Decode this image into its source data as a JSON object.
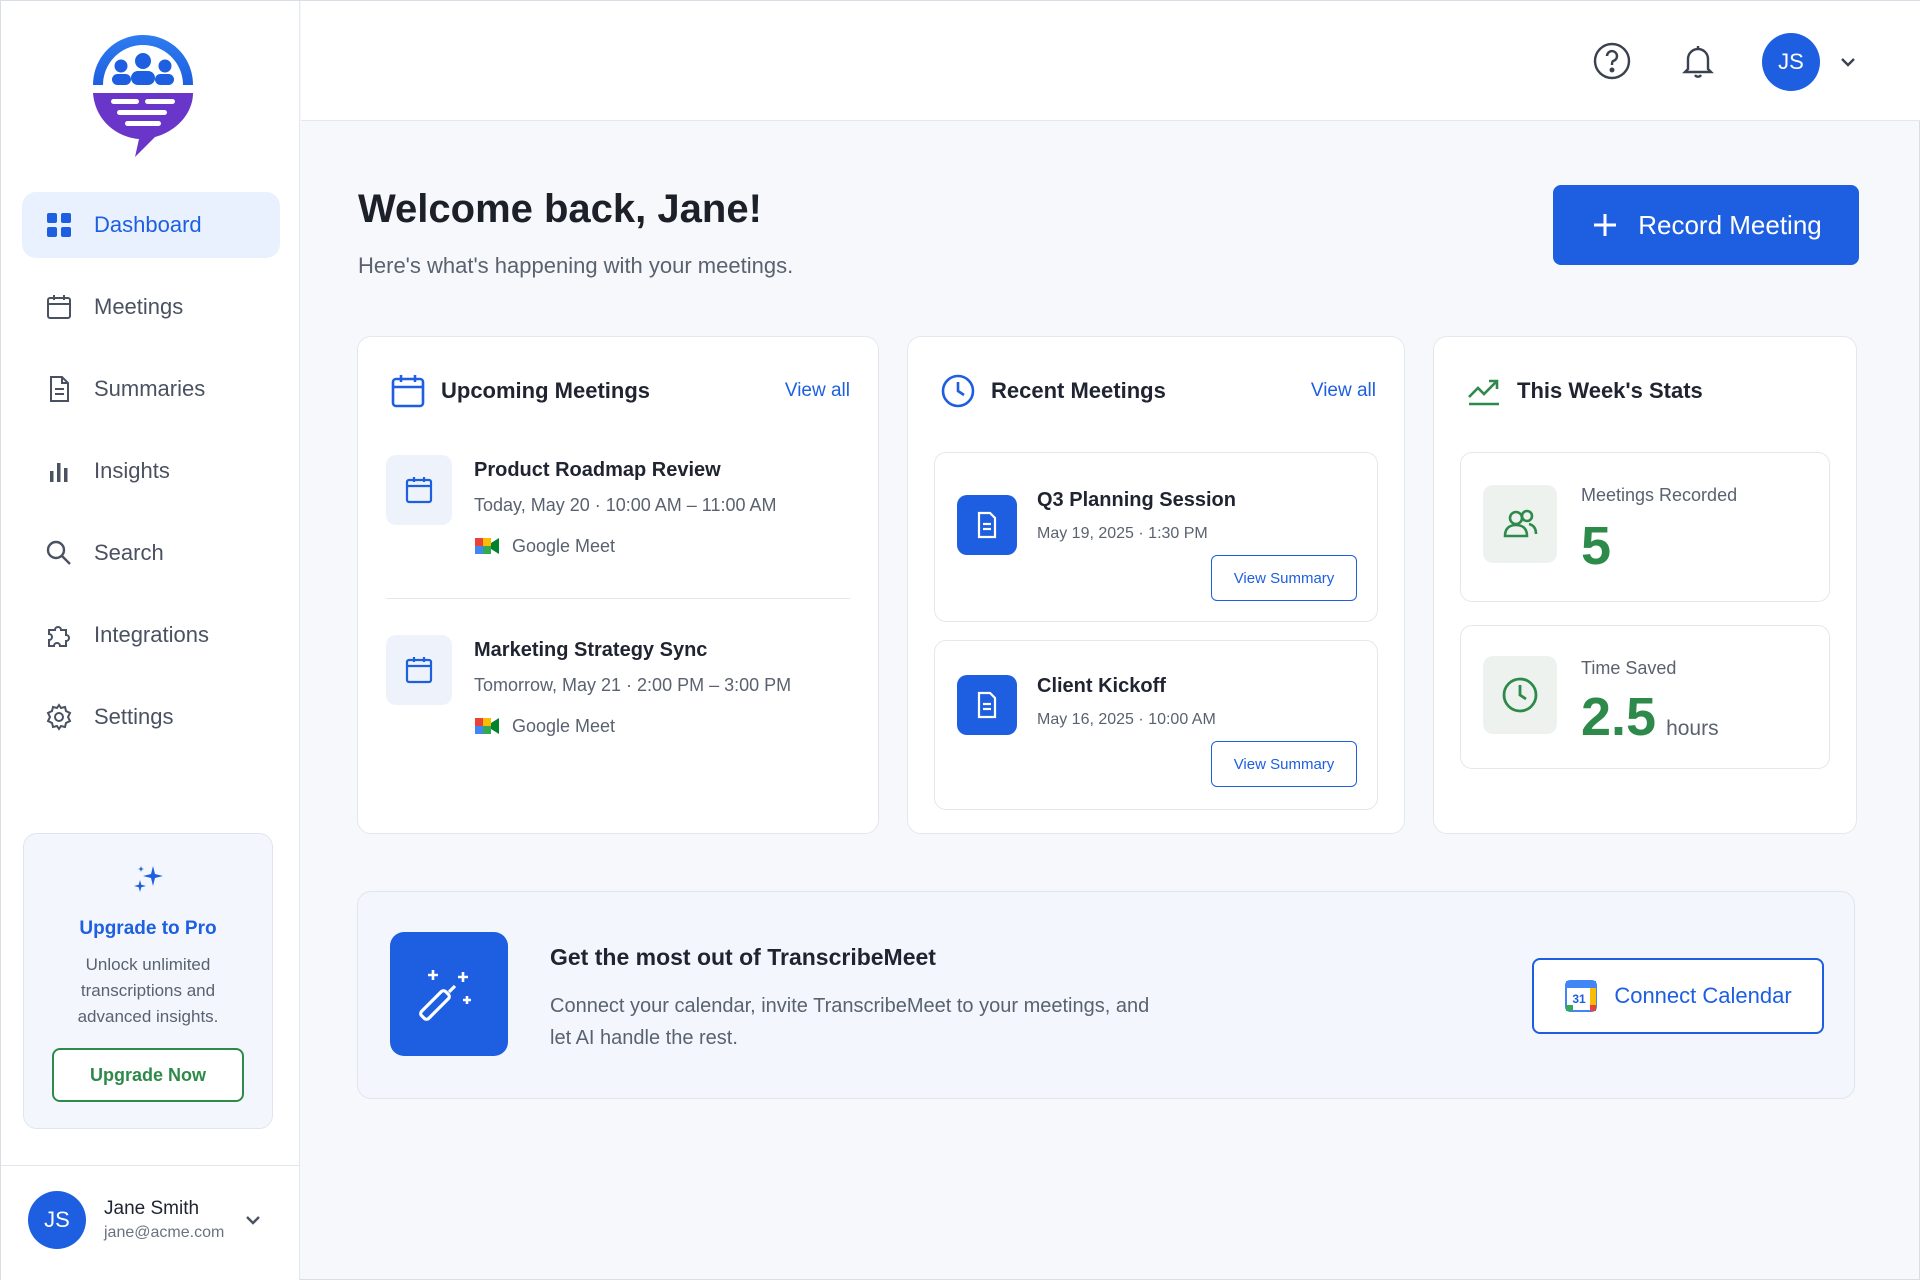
{
  "app": {
    "name": "TranscribeMeet"
  },
  "sidebar": {
    "items": [
      {
        "label": "Dashboard",
        "icon": "dashboard-icon",
        "active": true
      },
      {
        "label": "Meetings",
        "icon": "calendar-icon"
      },
      {
        "label": "Summaries",
        "icon": "document-icon"
      },
      {
        "label": "Insights",
        "icon": "bar-chart-icon"
      },
      {
        "label": "Search",
        "icon": "search-icon"
      },
      {
        "label": "Integrations",
        "icon": "puzzle-icon"
      },
      {
        "label": "Settings",
        "icon": "gear-icon"
      }
    ],
    "upgrade": {
      "title": "Upgrade to Pro",
      "text": "Unlock unlimited transcriptions and advanced insights.",
      "button": "Upgrade Now"
    },
    "user": {
      "initials": "JS",
      "name": "Jane Smith",
      "email": "jane@acme.com"
    }
  },
  "header": {
    "avatar_initials": "JS"
  },
  "main": {
    "welcome": "Welcome back, Jane!",
    "subtitle": "Here's what's happening with your meetings.",
    "record_button": "Record Meeting",
    "upcoming": {
      "title": "Upcoming Meetings",
      "view_all": "View all",
      "meetings": [
        {
          "title": "Product Roadmap Review",
          "time": "Today, May 20 · 10:00 AM – 11:00 AM",
          "platform": "Google Meet"
        },
        {
          "title": "Marketing Strategy Sync",
          "time": "Tomorrow, May 21 · 2:00 PM – 3:00 PM",
          "platform": "Google Meet"
        }
      ]
    },
    "recent": {
      "title": "Recent Meetings",
      "view_all": "View all",
      "meetings": [
        {
          "title": "Q3 Planning Session",
          "meta": "May 19, 2025 · 1:30 PM",
          "button": "View Summary"
        },
        {
          "title": "Client Kickoff",
          "meta": "May 16, 2025 · 10:00 AM",
          "button": "View Summary"
        }
      ]
    },
    "stats": {
      "title": "This Week's Stats",
      "items": [
        {
          "label": "Meetings Recorded",
          "value": "5",
          "unit": ""
        },
        {
          "label": "Time Saved",
          "value": "2.5",
          "unit": "hours"
        }
      ]
    },
    "banner": {
      "title": "Get the most out of TranscribeMeet",
      "text": "Connect your calendar, invite TranscribeMeet to your meetings, and let AI handle the rest.",
      "button": "Connect Calendar",
      "calendar_day": "31"
    }
  },
  "colors": {
    "primary": "#1d5fe0",
    "success": "#2e8a4a",
    "purple": "#6a35c9",
    "background": "#f6f8fb"
  }
}
